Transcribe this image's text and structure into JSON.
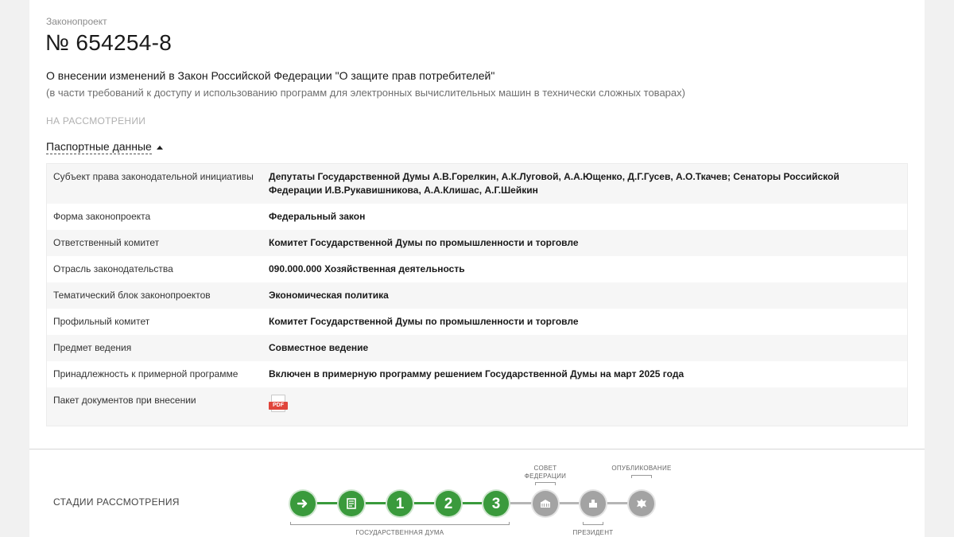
{
  "bill": {
    "type_label": "Законопроект",
    "number": "№ 654254-8",
    "title": "О внесении изменений в Закон Российской Федерации \"О защите прав потребителей\"",
    "subtitle": "(в части требований к доступу и использованию программ для электронных вычислительных машин в технически сложных товарах)",
    "status": "НА РАССМОТРЕНИИ"
  },
  "passport": {
    "toggle_label": "Паспортные данные",
    "rows": [
      {
        "key": "Субъект права законодательной инициативы",
        "value": "Депутаты Государственной Думы А.В.Горелкин, А.К.Луговой, А.А.Ющенко, Д.Г.Гусев, А.О.Ткачев; Сенаторы Российской Федерации И.В.Рукавишникова, А.А.Клишас, А.Г.Шейкин"
      },
      {
        "key": "Форма законопроекта",
        "value": "Федеральный закон"
      },
      {
        "key": "Ответственный комитет",
        "value": "Комитет Государственной Думы по промышленности и торговле"
      },
      {
        "key": "Отрасль законодательства",
        "value": "090.000.000 Хозяйственная деятельность"
      },
      {
        "key": "Тематический блок законопроектов",
        "value": "Экономическая политика"
      },
      {
        "key": "Профильный комитет",
        "value": "Комитет Государственной Думы по промышленности и торговле"
      },
      {
        "key": "Предмет ведения",
        "value": "Совместное ведение"
      },
      {
        "key": "Принадлежность к примерной программе",
        "value": "Включен в примерную программу решением Государственной Думы на март 2025 года"
      },
      {
        "key": "Пакет документов при внесении",
        "value": "",
        "attachment": "PDF"
      }
    ]
  },
  "stages": {
    "label": "СТАДИИ РАССМОТРЕНИЯ",
    "items": [
      {
        "icon": "arrow-right-icon",
        "state": "done"
      },
      {
        "icon": "document-icon",
        "state": "done"
      },
      {
        "text": "1",
        "state": "done"
      },
      {
        "text": "2",
        "state": "done"
      },
      {
        "text": "3",
        "state": "done"
      },
      {
        "icon": "federation-council-icon",
        "state": "pending"
      },
      {
        "icon": "president-icon",
        "state": "pending"
      },
      {
        "icon": "emblem-icon",
        "state": "pending"
      }
    ],
    "captions": {
      "duma": "ГОСУДАРСТВЕННАЯ ДУМА",
      "federation_council": "СОВЕТ ФЕДЕРАЦИИ",
      "president": "ПРЕЗИДЕНТ",
      "publication": "ОПУБЛИКОВАНИЕ"
    },
    "colors": {
      "done": "#3a9a3c",
      "pending": "#a3a3a3"
    }
  }
}
